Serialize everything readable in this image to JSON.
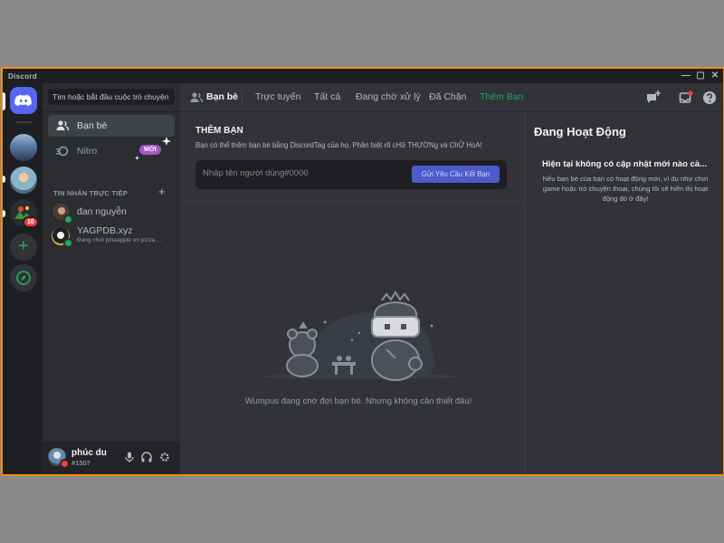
{
  "window": {
    "title": "Discord",
    "controls": [
      "—",
      "▢",
      "✕"
    ]
  },
  "servers": {
    "notification_count": "10"
  },
  "sidebar": {
    "search_placeholder": "Tìm hoặc bắt đầu cuộc trò chuyện",
    "nav": [
      {
        "label": "Bạn bè",
        "icon": "friends-icon"
      },
      {
        "label": "Nitro",
        "icon": "nitro-icon",
        "badge": "MỚI"
      }
    ],
    "dm_section_label": "TIN NHẮN TRỰC TIẾP",
    "dms": [
      {
        "name": "đan nguyễn",
        "status": ""
      },
      {
        "name": "YAGPDB.xyz",
        "status": "Đang chơi pineapple on pizza ..."
      }
    ],
    "user": {
      "name": "phúc du",
      "tag": "#1507"
    }
  },
  "header": {
    "title": "Bạn bè",
    "tabs": [
      "Trực tuyến",
      "Tất cả",
      "Đang chờ xử lý",
      "Đã Chặn",
      "Thêm Bạn"
    ]
  },
  "add_friend": {
    "title": "THÊM BẠN",
    "description": "Bạn có thể thêm bạn bè bằng DiscordTag của họ. Phân biệt rõ cHữ THƯỜNg và ChỮ HoA!",
    "placeholder": "Nhập tên người dùng#0000",
    "button": "Gửi Yêu Cầu Kết Bạn"
  },
  "empty_state": "Wumpus đang chờ đợi bạn bè. Nhưng không cần thiết đâu!",
  "activity": {
    "title": "Đang Hoạt Động",
    "heading": "Hiện tại không có cập nhật mới nào cả...",
    "description": "Nếu bạn bè của bạn có hoạt động mới, ví dụ như chơi game hoặc trò chuyện thoại, chúng tôi sẽ hiển thị hoạt động đó ở đây!"
  },
  "colors": {
    "accent": "#5865f2",
    "border": "#f08a1c",
    "online": "#23a559",
    "dnd": "#f23f43",
    "nitro_badge": "#a855c8"
  }
}
